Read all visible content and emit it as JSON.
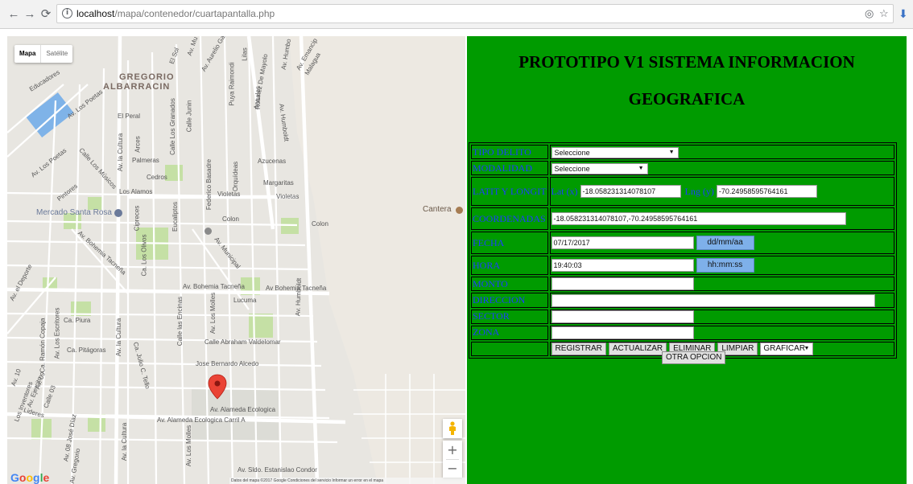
{
  "browser": {
    "url_host": "localhost",
    "url_path": "/mapa/contenedor/cuartapantalla.php"
  },
  "map": {
    "type_control": {
      "map_label": "Mapa",
      "satellite_label": "Satélite"
    },
    "labels": {
      "gregorio": "GREGORIO",
      "albarracin": "ALBARRACIN",
      "el_peral": "El Peral",
      "educadores": "Educadores",
      "av_los_poetas_1": "Av. Los Poetas",
      "av_los_poetas_2": "Av. Los Poetas",
      "calle_los_musicos": "Calle Los Músicos",
      "pintores": "Pintores",
      "palmeras": "Palmeras",
      "cedros": "Cedros",
      "los_alamos": "Los Alamos",
      "azucenas": "Azucenas",
      "margaritas": "Margaritas",
      "violetas_1": "Violetas",
      "violetas_2": "Violetas",
      "colon_1": "Colon",
      "colon_2": "Colon",
      "mercado": "Mercado Santa Rosa",
      "cantera": "Cantera",
      "av_bohemia_1": "Av. Bohemia Tacneña",
      "av_bohemia_2": "Av. Bohemia Tacneña",
      "av_bohemia_3": "Av Bohemia Tacneña",
      "lucuma": "Lucuma",
      "ca_piura": "Ca. Piura",
      "ca_pitagoras": "Ca. Pitágoras",
      "calle_abraham": "Calle Abraham Valdelomar",
      "jose_bernardo": "Jose Bernardo Alcedo",
      "av_alameda_1": "Av. Alameda Ecologica",
      "av_alameda_2": "Av. Alameda Ecologica Carril A",
      "estanislao": "Av. Sldo. Estanislao Condor",
      "av_el_deporte": "Av. el Deporte",
      "av_humboldt_1": "Av. Humboldt",
      "av_humboldt_2": "Av. Humboldt",
      "av_municipal": "Av. Municipal",
      "federico_basadre": "Federico Basadre",
      "orquideas": "Orquídeas",
      "eucaliptos": "Eucaliptos",
      "ca_los_olivos": "Ca. Los Olivos",
      "av_la_cultura": "Av. la Cultura",
      "av_los_molles": "Av. Los Molles",
      "lideres": "Lideres",
      "av_gregorio": "Av. Gregorio",
      "los_incas_top": "Av. Mu",
      "el_sol": "El Sol",
      "aurelio": "Av. Aurelio Garc",
      "puya_raimondi": "Puya Raimondi",
      "lilas": "Lilas",
      "rosales": "Rosales",
      "antunez": "Antunez De Mayolo",
      "av_humb_top": "Av. Humbo",
      "emancipacion": "Av. Emancip",
      "malaga": "Malagua",
      "calle_junin": "Calle Junin",
      "los_granados": "Calle Los Granados",
      "ca_cultura_top": "Av. la Cultura",
      "arces": "Arces",
      "cipreces": "Cipreces",
      "calle_las_encinas": "Calle las Encinas",
      "ca_julio_c_tello": "Ca. Julio C. Tello",
      "av_los_escritores": "Av. Los Escritores",
      "ca_ramon_copaja": "Ca. Ramón Copaja",
      "av_la_cultura_bottom": "Av. la Cultura",
      "av_los_molles_bottom": "Av. Los Molles",
      "av_08_jose_diaz": "Av. 08 José Díaz",
      "los_inventores": "Los Inventores",
      "av_10": "Av. 10",
      "av_09": "Av. 09",
      "calle_03": "Calle 03",
      "av_ejercito": "Av. Ejercito"
    },
    "google_logo": "Google",
    "footer_text": "Datos del mapa ©2017 Google    Condiciones del servicio    Informar un error en el mapa",
    "marker_icon": "map-pin-icon",
    "zoom_in": "+",
    "zoom_out": "−"
  },
  "form": {
    "title_line1": "PROTOTIPO V1 SISTEMA INFORMACION",
    "title_line2": "GEOGRAFICA",
    "labels": {
      "tipo_delito": "TIPO DELITO",
      "modalidad": "MODALIDAD",
      "latit_longit": "LATIT Y LONGIT",
      "coordenadas": "COORDENADAS",
      "fecha": "FECHA",
      "hora": "HORA",
      "monto": "MONTO",
      "direccion": "DIRECCION",
      "sector": "SECTOR",
      "zona": "ZONA"
    },
    "tipo_delito_value": "Seleccione",
    "modalidad_value": "Seleccione",
    "lat_label": "Lat (x)",
    "lat_value": "-18.058231314078107",
    "lng_label": "Lng (y)",
    "lng_value": "-70.24958595764161",
    "coordenadas_value": "-18.058231314078107,-70.24958595764161",
    "fecha_value": "07/17/2017",
    "fecha_button": "dd/mm/aa",
    "hora_value": "19:40:03",
    "hora_button": "hh:mm:ss",
    "monto_value": "",
    "direccion_value": "",
    "sector_value": "",
    "zona_value": "",
    "buttons": {
      "registrar": "REGISTRAR",
      "actualizar": "ACTUALIZAR",
      "eliminar": "ELIMINAR",
      "limpiar": "LIMPIAR",
      "graficar": "GRAFICAR"
    },
    "otra_opcion": "OTRA OPCION",
    "panel_color": "#009b00",
    "label_color": "#1e3dff"
  }
}
